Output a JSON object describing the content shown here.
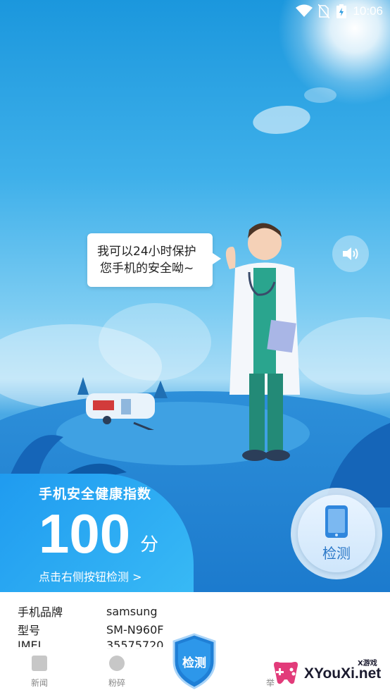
{
  "status_bar": {
    "time": "10:06"
  },
  "speech_bubble": {
    "line1": "我可以24小时保护",
    "line2": "您手机的安全呦~"
  },
  "score": {
    "title": "手机安全健康指数",
    "value": "100",
    "unit": "分",
    "link": "点击右侧按钮检测 >"
  },
  "detect_button": {
    "label": "检测"
  },
  "device_info": [
    {
      "key": "手机品牌",
      "value": "samsung"
    },
    {
      "key": "型号",
      "value": "SM-N960F"
    },
    {
      "key": "IMEI",
      "value": "35575720"
    }
  ],
  "bottom_nav": {
    "items": [
      {
        "label": "新闻",
        "icon": "news-icon"
      },
      {
        "label": "粉碎",
        "icon": "shred-icon"
      },
      {
        "label": "检测",
        "icon": "shield-icon"
      },
      {
        "label": "举",
        "icon": "report-icon"
      }
    ]
  },
  "watermark": {
    "text": "XYouXi.net",
    "sub": "X游戏"
  },
  "colors": {
    "accent": "#1f9bf0",
    "detect_text": "#2b78c8"
  }
}
